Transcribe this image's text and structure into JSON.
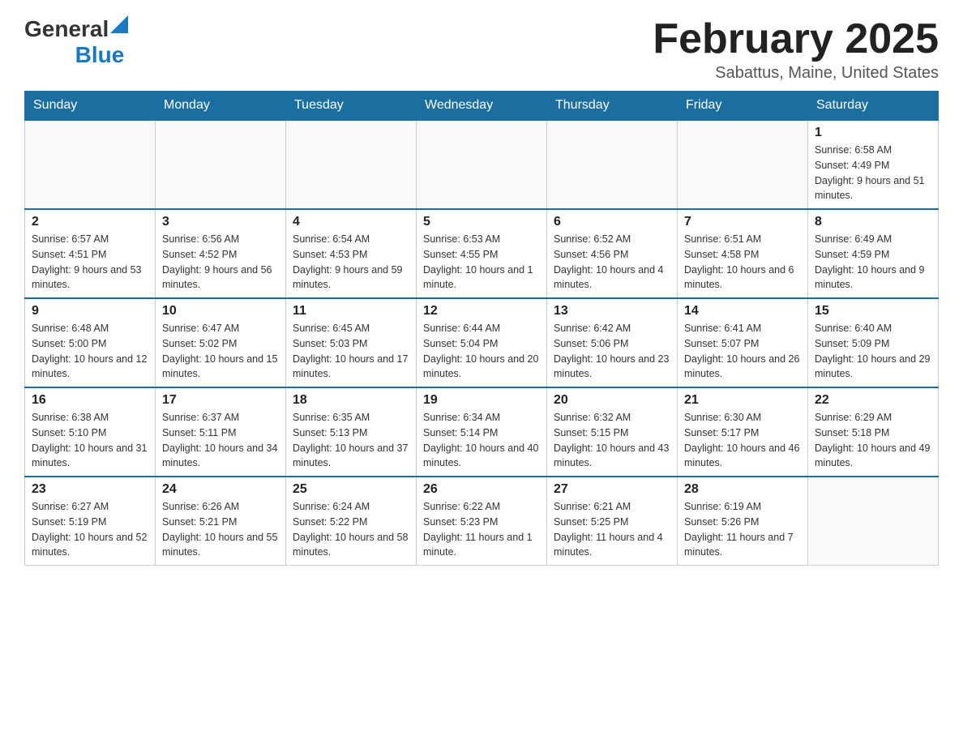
{
  "header": {
    "logo_general": "General",
    "logo_blue": "Blue",
    "month_title": "February 2025",
    "location": "Sabattus, Maine, United States"
  },
  "days_of_week": [
    "Sunday",
    "Monday",
    "Tuesday",
    "Wednesday",
    "Thursday",
    "Friday",
    "Saturday"
  ],
  "weeks": [
    [
      {
        "day": "",
        "info": ""
      },
      {
        "day": "",
        "info": ""
      },
      {
        "day": "",
        "info": ""
      },
      {
        "day": "",
        "info": ""
      },
      {
        "day": "",
        "info": ""
      },
      {
        "day": "",
        "info": ""
      },
      {
        "day": "1",
        "info": "Sunrise: 6:58 AM\nSunset: 4:49 PM\nDaylight: 9 hours and 51 minutes."
      }
    ],
    [
      {
        "day": "2",
        "info": "Sunrise: 6:57 AM\nSunset: 4:51 PM\nDaylight: 9 hours and 53 minutes."
      },
      {
        "day": "3",
        "info": "Sunrise: 6:56 AM\nSunset: 4:52 PM\nDaylight: 9 hours and 56 minutes."
      },
      {
        "day": "4",
        "info": "Sunrise: 6:54 AM\nSunset: 4:53 PM\nDaylight: 9 hours and 59 minutes."
      },
      {
        "day": "5",
        "info": "Sunrise: 6:53 AM\nSunset: 4:55 PM\nDaylight: 10 hours and 1 minute."
      },
      {
        "day": "6",
        "info": "Sunrise: 6:52 AM\nSunset: 4:56 PM\nDaylight: 10 hours and 4 minutes."
      },
      {
        "day": "7",
        "info": "Sunrise: 6:51 AM\nSunset: 4:58 PM\nDaylight: 10 hours and 6 minutes."
      },
      {
        "day": "8",
        "info": "Sunrise: 6:49 AM\nSunset: 4:59 PM\nDaylight: 10 hours and 9 minutes."
      }
    ],
    [
      {
        "day": "9",
        "info": "Sunrise: 6:48 AM\nSunset: 5:00 PM\nDaylight: 10 hours and 12 minutes."
      },
      {
        "day": "10",
        "info": "Sunrise: 6:47 AM\nSunset: 5:02 PM\nDaylight: 10 hours and 15 minutes."
      },
      {
        "day": "11",
        "info": "Sunrise: 6:45 AM\nSunset: 5:03 PM\nDaylight: 10 hours and 17 minutes."
      },
      {
        "day": "12",
        "info": "Sunrise: 6:44 AM\nSunset: 5:04 PM\nDaylight: 10 hours and 20 minutes."
      },
      {
        "day": "13",
        "info": "Sunrise: 6:42 AM\nSunset: 5:06 PM\nDaylight: 10 hours and 23 minutes."
      },
      {
        "day": "14",
        "info": "Sunrise: 6:41 AM\nSunset: 5:07 PM\nDaylight: 10 hours and 26 minutes."
      },
      {
        "day": "15",
        "info": "Sunrise: 6:40 AM\nSunset: 5:09 PM\nDaylight: 10 hours and 29 minutes."
      }
    ],
    [
      {
        "day": "16",
        "info": "Sunrise: 6:38 AM\nSunset: 5:10 PM\nDaylight: 10 hours and 31 minutes."
      },
      {
        "day": "17",
        "info": "Sunrise: 6:37 AM\nSunset: 5:11 PM\nDaylight: 10 hours and 34 minutes."
      },
      {
        "day": "18",
        "info": "Sunrise: 6:35 AM\nSunset: 5:13 PM\nDaylight: 10 hours and 37 minutes."
      },
      {
        "day": "19",
        "info": "Sunrise: 6:34 AM\nSunset: 5:14 PM\nDaylight: 10 hours and 40 minutes."
      },
      {
        "day": "20",
        "info": "Sunrise: 6:32 AM\nSunset: 5:15 PM\nDaylight: 10 hours and 43 minutes."
      },
      {
        "day": "21",
        "info": "Sunrise: 6:30 AM\nSunset: 5:17 PM\nDaylight: 10 hours and 46 minutes."
      },
      {
        "day": "22",
        "info": "Sunrise: 6:29 AM\nSunset: 5:18 PM\nDaylight: 10 hours and 49 minutes."
      }
    ],
    [
      {
        "day": "23",
        "info": "Sunrise: 6:27 AM\nSunset: 5:19 PM\nDaylight: 10 hours and 52 minutes."
      },
      {
        "day": "24",
        "info": "Sunrise: 6:26 AM\nSunset: 5:21 PM\nDaylight: 10 hours and 55 minutes."
      },
      {
        "day": "25",
        "info": "Sunrise: 6:24 AM\nSunset: 5:22 PM\nDaylight: 10 hours and 58 minutes."
      },
      {
        "day": "26",
        "info": "Sunrise: 6:22 AM\nSunset: 5:23 PM\nDaylight: 11 hours and 1 minute."
      },
      {
        "day": "27",
        "info": "Sunrise: 6:21 AM\nSunset: 5:25 PM\nDaylight: 11 hours and 4 minutes."
      },
      {
        "day": "28",
        "info": "Sunrise: 6:19 AM\nSunset: 5:26 PM\nDaylight: 11 hours and 7 minutes."
      },
      {
        "day": "",
        "info": ""
      }
    ]
  ],
  "colors": {
    "header_bg": "#1a6fa0",
    "header_text": "#ffffff",
    "border": "#cccccc",
    "accent": "#1a7abf"
  }
}
